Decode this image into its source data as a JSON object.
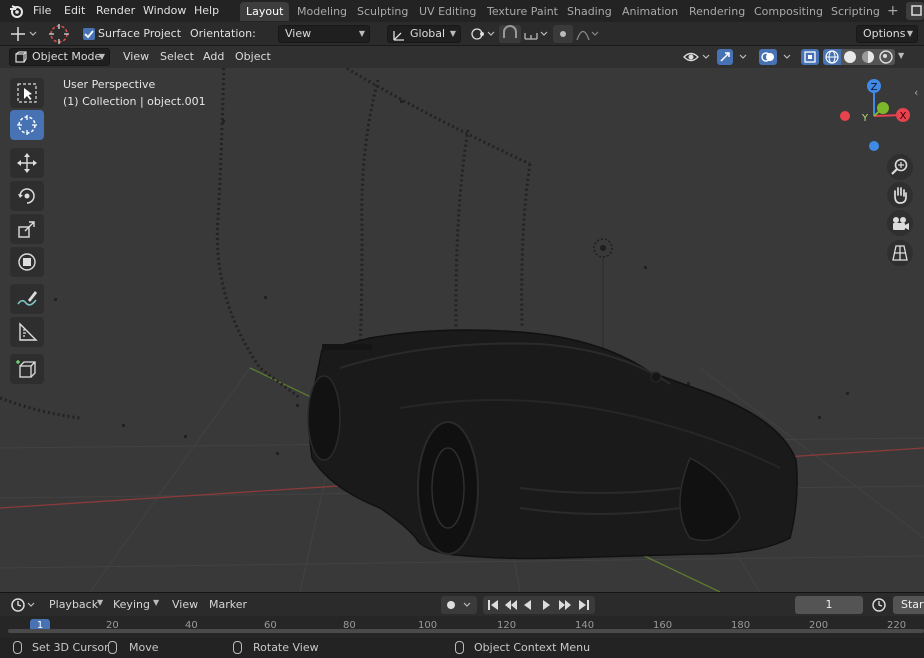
{
  "menu": {
    "items": [
      "File",
      "Edit",
      "Render",
      "Window",
      "Help"
    ]
  },
  "workspaces": [
    "Layout",
    "Modeling",
    "Sculpting",
    "UV Editing",
    "Texture Paint",
    "Shading",
    "Animation",
    "Rendering",
    "Compositing",
    "Scripting"
  ],
  "workspace_add": "+",
  "tool_settings": {
    "surface_project_label": "Surface Project",
    "surface_project_checked": true,
    "orientation_label": "Orientation:",
    "orientation_value": "View",
    "transform_orientation": "Global",
    "options_label": "Options"
  },
  "viewport_header": {
    "mode": "Object Mode",
    "menus": [
      "View",
      "Select",
      "Add",
      "Object"
    ]
  },
  "viewport": {
    "perspective_label": "User Perspective",
    "collection_label": "(1) Collection | object.001",
    "gizmo_axes": [
      "Z",
      "Y",
      "X"
    ]
  },
  "timeline": {
    "menus": [
      "Playback",
      "Keying",
      "View",
      "Marker"
    ],
    "current_frame": "1",
    "start_label": "Start",
    "ruler_ticks": [
      "1",
      "20",
      "40",
      "60",
      "80",
      "100",
      "120",
      "140",
      "160",
      "180",
      "200",
      "220"
    ]
  },
  "statusbar": {
    "items": [
      "Set 3D Cursor",
      "Move",
      "Rotate View",
      "Object Context Menu"
    ]
  },
  "colors": {
    "accent": "#4772b3",
    "axis_x": "#e8424f",
    "axis_y": "#7db82a",
    "axis_z": "#3f8ae6"
  }
}
